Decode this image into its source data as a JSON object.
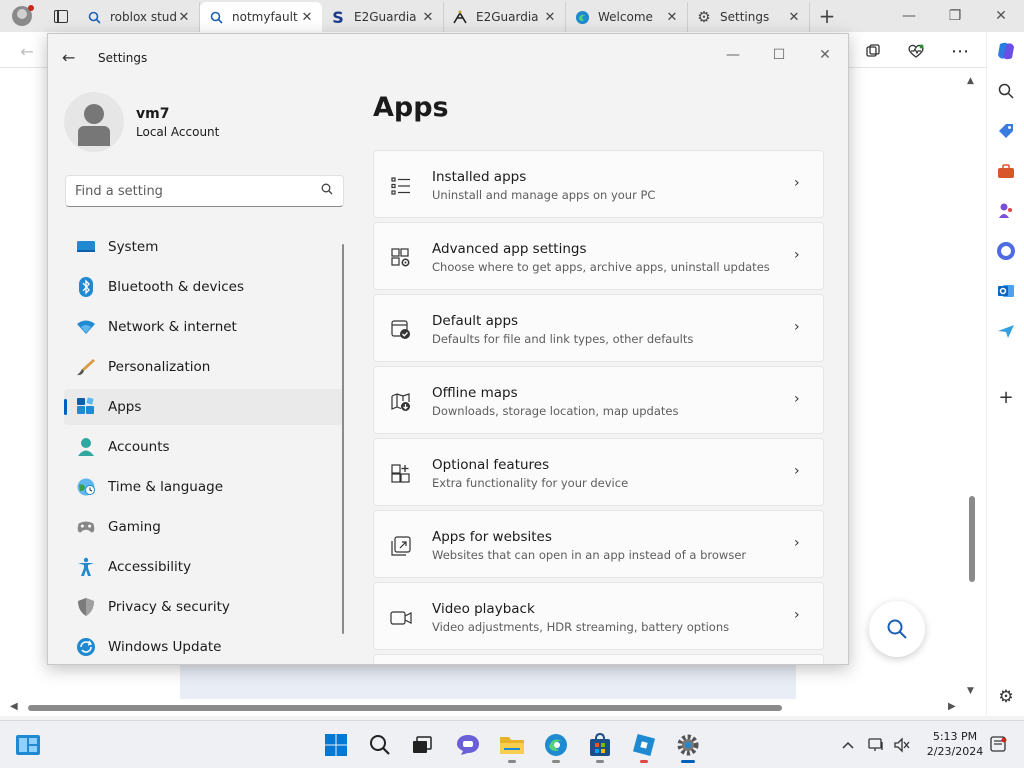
{
  "browser": {
    "tabs": [
      {
        "label": "roblox stud",
        "icon": "search-icon"
      },
      {
        "label": "notmyfault",
        "icon": "search-icon",
        "active": true
      },
      {
        "label": "E2Guardia",
        "icon": "s-logo-icon"
      },
      {
        "label": "E2Guardia",
        "icon": "e2guardian-logo-icon"
      },
      {
        "label": "Welcome",
        "icon": "edge-logo-icon"
      },
      {
        "label": "Settings",
        "icon": "gear-icon"
      }
    ]
  },
  "settings": {
    "window_title": "Settings",
    "user": {
      "name": "vm7",
      "account_type": "Local Account"
    },
    "search": {
      "placeholder": "Find a setting"
    },
    "nav": [
      {
        "label": "System",
        "icon": "monitor-icon"
      },
      {
        "label": "Bluetooth & devices",
        "icon": "bluetooth-icon"
      },
      {
        "label": "Network & internet",
        "icon": "wifi-icon"
      },
      {
        "label": "Personalization",
        "icon": "brush-icon"
      },
      {
        "label": "Apps",
        "icon": "apps-icon",
        "selected": true
      },
      {
        "label": "Accounts",
        "icon": "person-icon"
      },
      {
        "label": "Time & language",
        "icon": "globe-clock-icon"
      },
      {
        "label": "Gaming",
        "icon": "gamepad-icon"
      },
      {
        "label": "Accessibility",
        "icon": "accessibility-icon"
      },
      {
        "label": "Privacy & security",
        "icon": "shield-icon"
      },
      {
        "label": "Windows Update",
        "icon": "update-icon"
      }
    ],
    "page_title": "Apps",
    "cards": [
      {
        "title": "Installed apps",
        "desc": "Uninstall and manage apps on your PC",
        "icon": "list-icon"
      },
      {
        "title": "Advanced app settings",
        "desc": "Choose where to get apps, archive apps, uninstall updates",
        "icon": "app-gear-icon"
      },
      {
        "title": "Default apps",
        "desc": "Defaults for file and link types, other defaults",
        "icon": "default-apps-icon"
      },
      {
        "title": "Offline maps",
        "desc": "Downloads, storage location, map updates",
        "icon": "map-download-icon"
      },
      {
        "title": "Optional features",
        "desc": "Extra functionality for your device",
        "icon": "add-grid-icon"
      },
      {
        "title": "Apps for websites",
        "desc": "Websites that can open in an app instead of a browser",
        "icon": "open-external-icon"
      },
      {
        "title": "Video playback",
        "desc": "Video adjustments, HDR streaming, battery options",
        "icon": "video-icon"
      }
    ]
  },
  "taskbar": {
    "time": "5:13 PM",
    "date": "2/23/2024"
  },
  "colors": {
    "accent": "#005fb8",
    "windows_blue": "#0078d4"
  }
}
